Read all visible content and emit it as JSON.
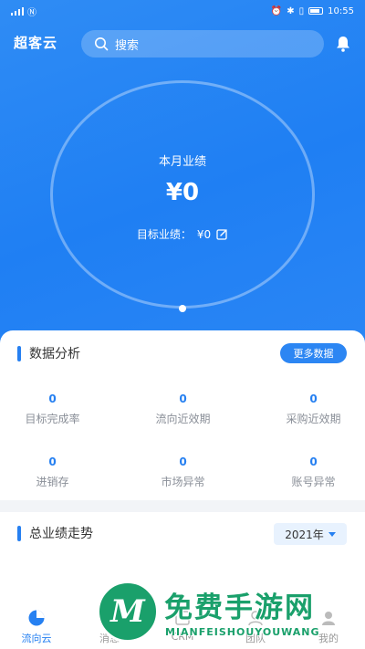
{
  "status_bar": {
    "time": "10:55"
  },
  "header": {
    "brand": "超客云",
    "search_placeholder": "搜索"
  },
  "hero": {
    "label": "本月业绩",
    "amount": "¥0",
    "target_label": "目标业绩：",
    "target_value": "¥0"
  },
  "analysis": {
    "title": "数据分析",
    "more_label": "更多数据",
    "metrics": [
      {
        "value": "0",
        "label": "目标完成率"
      },
      {
        "value": "0",
        "label": "流向近效期"
      },
      {
        "value": "0",
        "label": "采购近效期"
      },
      {
        "value": "0",
        "label": "进销存"
      },
      {
        "value": "0",
        "label": "市场异常"
      },
      {
        "value": "0",
        "label": "账号异常"
      }
    ]
  },
  "trend": {
    "title": "总业绩走势",
    "year": "2021年"
  },
  "tabs": [
    {
      "label": "流向云",
      "icon": "pie-chart-icon",
      "active": true
    },
    {
      "label": "消息",
      "icon": "message-icon"
    },
    {
      "label": "CRM",
      "icon": "crm-icon"
    },
    {
      "label": "团队",
      "icon": "team-icon"
    },
    {
      "label": "我的",
      "icon": "profile-icon"
    }
  ],
  "watermark": {
    "title": "免费手游网",
    "subtitle": "MIANFEISHOUYOUWANG",
    "logo_letter": "M"
  },
  "colors": {
    "primary": "#2680f1",
    "hero_bg": "#2f8cf4",
    "watermark": "#1aa06b"
  }
}
